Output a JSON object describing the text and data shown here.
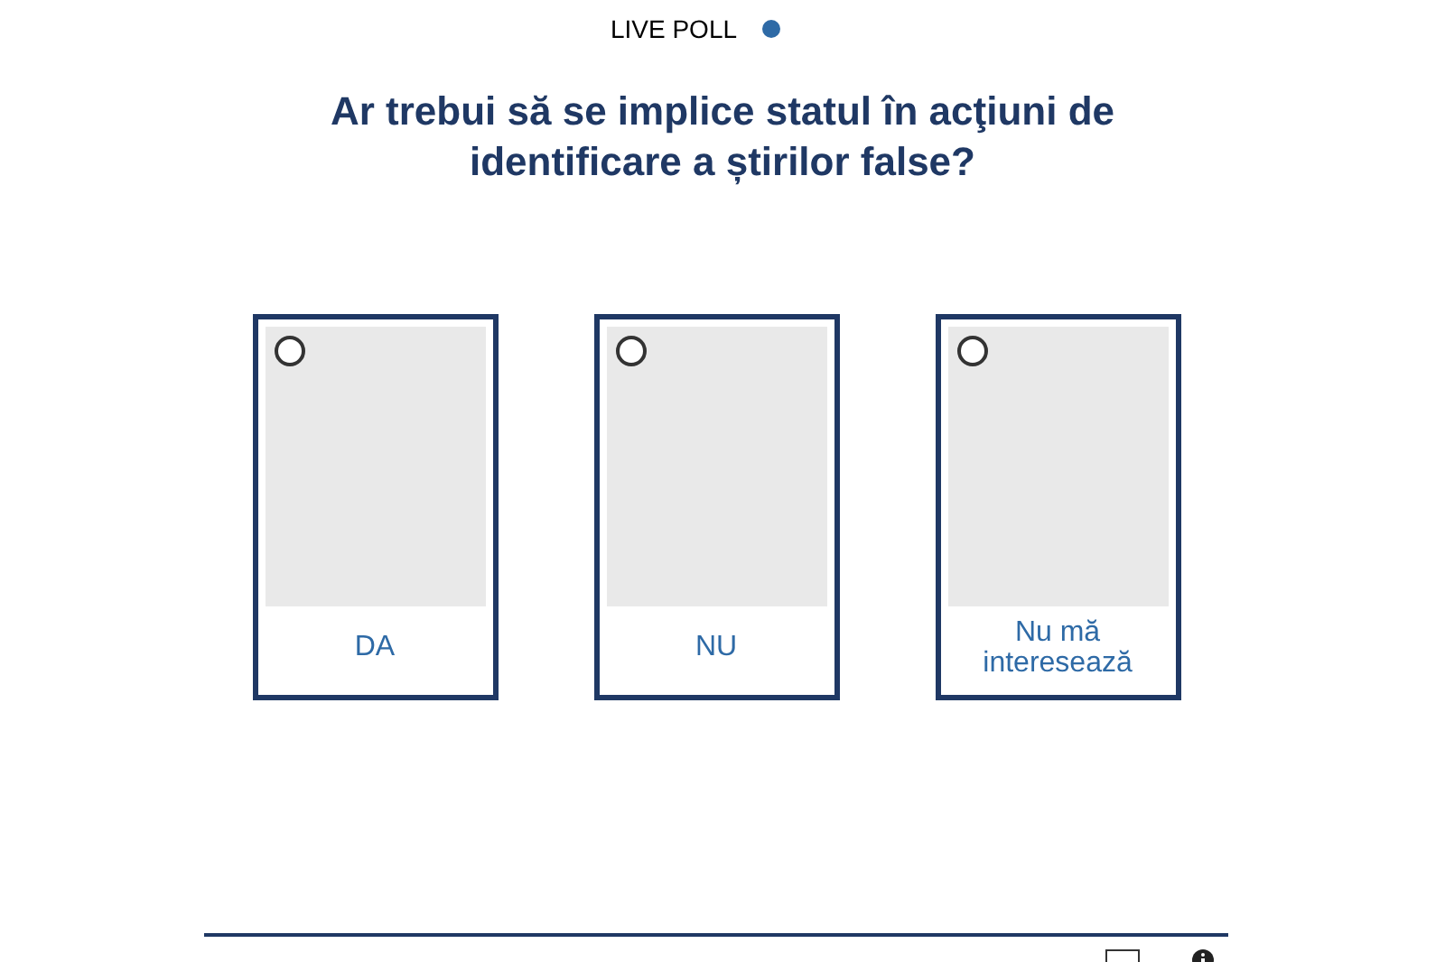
{
  "header": {
    "label": "LIVE POLL"
  },
  "question": "Ar trebui să se implice statul în acţiuni de identificare a știrilor false?",
  "options": [
    {
      "label": "DA",
      "selected": false
    },
    {
      "label": "NU",
      "selected": false
    },
    {
      "label": "Nu mă interesează",
      "selected": false
    }
  ]
}
